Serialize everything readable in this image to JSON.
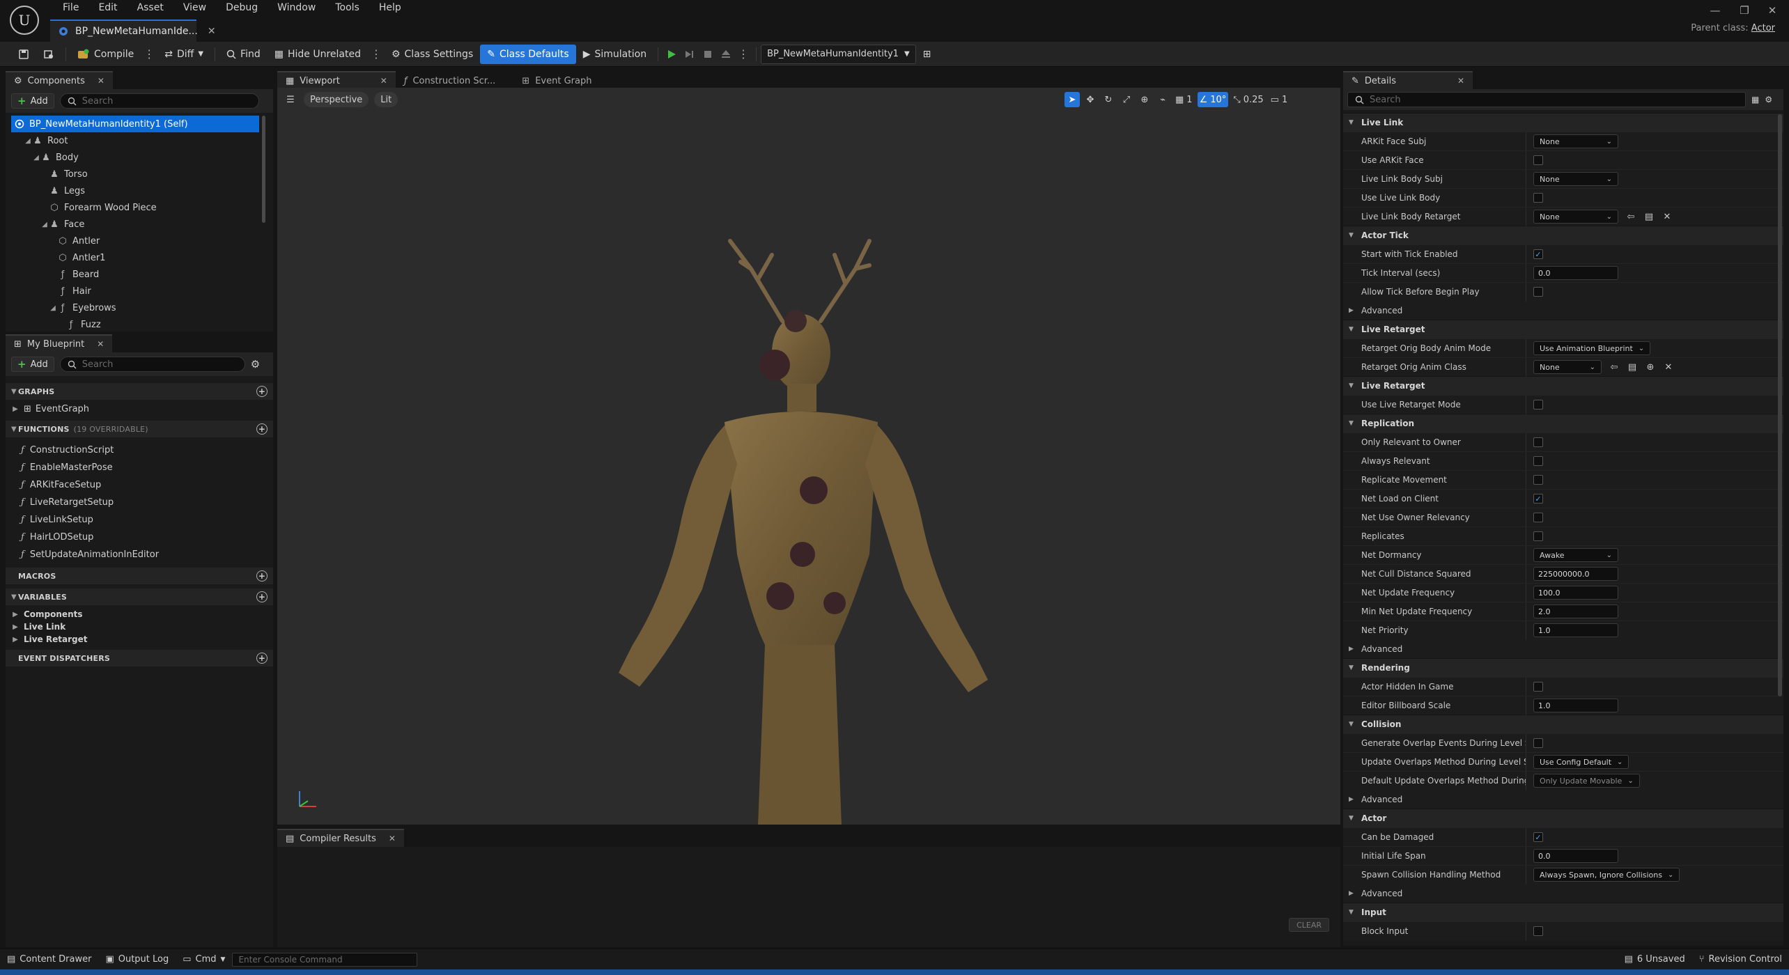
{
  "titlebar": {
    "menu": [
      "File",
      "Edit",
      "Asset",
      "View",
      "Debug",
      "Window",
      "Tools",
      "Help"
    ],
    "doc_tab": "BP_NewMetaHumanIde...",
    "parent_class_label": "Parent class:",
    "parent_class_value": "Actor"
  },
  "toolbar": {
    "compile": "Compile",
    "diff": "Diff",
    "find": "Find",
    "hide_unrelated": "Hide Unrelated",
    "class_settings": "Class Settings",
    "class_defaults": "Class Defaults",
    "simulation": "Simulation",
    "debug_object": "BP_NewMetaHumanIdentity1"
  },
  "components": {
    "tab": "Components",
    "add": "Add",
    "search_placeholder": "Search",
    "tree": [
      {
        "label": "BP_NewMetaHumanIdentity1 (Self)",
        "icon": "self-icon"
      },
      {
        "label": "Root",
        "icon": "skeletal-mesh-icon"
      },
      {
        "label": "Body",
        "icon": "skeletal-mesh-icon"
      },
      {
        "label": "Torso",
        "icon": "skeletal-mesh-icon"
      },
      {
        "label": "Legs",
        "icon": "skeletal-mesh-icon"
      },
      {
        "label": "Forearm Wood Piece",
        "icon": "static-mesh-icon"
      },
      {
        "label": "Face",
        "icon": "skeletal-mesh-icon"
      },
      {
        "label": "Antler",
        "icon": "static-mesh-icon"
      },
      {
        "label": "Antler1",
        "icon": "static-mesh-icon"
      },
      {
        "label": "Beard",
        "icon": "groom-icon"
      },
      {
        "label": "Hair",
        "icon": "groom-icon"
      },
      {
        "label": "Eyebrows",
        "icon": "groom-icon"
      },
      {
        "label": "Fuzz",
        "icon": "groom-icon"
      }
    ]
  },
  "myblueprint": {
    "tab": "My Blueprint",
    "add": "Add",
    "search_placeholder": "Search",
    "graphs_header": "GRAPHS",
    "graphs": [
      "EventGraph"
    ],
    "functions_header": "FUNCTIONS",
    "functions_count": "(19 OVERRIDABLE)",
    "functions": [
      "ConstructionScript",
      "EnableMasterPose",
      "ARKitFaceSetup",
      "LiveRetargetSetup",
      "LiveLinkSetup",
      "HairLODSetup",
      "SetUpdateAnimationInEditor"
    ],
    "macros_header": "MACROS",
    "variables_header": "VARIABLES",
    "variables": [
      "Components",
      "Live Link",
      "Live Retarget"
    ],
    "dispatchers_header": "EVENT DISPATCHERS"
  },
  "center_tabs": [
    "Viewport",
    "Construction Scr...",
    "Event Graph"
  ],
  "viewport": {
    "perspective": "Perspective",
    "lit": "Lit",
    "grid_value": "1",
    "angle_value": "10°",
    "scale_value": "0.25",
    "camera_value": "1"
  },
  "compiler": {
    "tab": "Compiler Results",
    "clear": "CLEAR"
  },
  "details": {
    "tab": "Details",
    "search_placeholder": "Search",
    "items": [
      {
        "type": "section",
        "label": "Live Link"
      },
      {
        "type": "row",
        "label": "ARKit Face Subj",
        "kind": "dropdown",
        "value": "None"
      },
      {
        "type": "row",
        "label": "Use ARKit Face",
        "kind": "check",
        "value": ""
      },
      {
        "type": "row",
        "label": "Live Link Body Subj",
        "kind": "dropdown",
        "value": "None"
      },
      {
        "type": "row",
        "label": "Use Live Link Body",
        "kind": "check",
        "value": ""
      },
      {
        "type": "row",
        "label": "Live Link Body Retarget",
        "kind": "dropdown-tools",
        "value": "None"
      },
      {
        "type": "section",
        "label": "Actor Tick"
      },
      {
        "type": "row",
        "label": "Start with Tick Enabled",
        "kind": "check",
        "value": "✓"
      },
      {
        "type": "row",
        "label": "Tick Interval (secs)",
        "kind": "number",
        "value": "0.0"
      },
      {
        "type": "row",
        "label": "Allow Tick Before Begin Play",
        "kind": "check",
        "value": ""
      },
      {
        "type": "sub",
        "label": "Advanced"
      },
      {
        "type": "section",
        "label": "Live Retarget"
      },
      {
        "type": "row",
        "label": "Retarget Orig Body Anim Mode",
        "kind": "dropdown-wide",
        "value": "Use Animation Blueprint"
      },
      {
        "type": "row",
        "label": "Retarget Orig Anim Class",
        "kind": "dropdown-tools2",
        "value": "None"
      },
      {
        "type": "section",
        "label": "Live Retarget"
      },
      {
        "type": "row",
        "label": "Use Live Retarget Mode",
        "kind": "check",
        "value": ""
      },
      {
        "type": "section",
        "label": "Replication"
      },
      {
        "type": "row",
        "label": "Only Relevant to Owner",
        "kind": "check",
        "value": ""
      },
      {
        "type": "row",
        "label": "Always Relevant",
        "kind": "check",
        "value": ""
      },
      {
        "type": "row",
        "label": "Replicate Movement",
        "kind": "check",
        "value": ""
      },
      {
        "type": "row",
        "label": "Net Load on Client",
        "kind": "check",
        "value": "✓"
      },
      {
        "type": "row",
        "label": "Net Use Owner Relevancy",
        "kind": "check",
        "value": ""
      },
      {
        "type": "row",
        "label": "Replicates",
        "kind": "check",
        "value": ""
      },
      {
        "type": "row",
        "label": "Net Dormancy",
        "kind": "dropdown",
        "value": "Awake"
      },
      {
        "type": "row",
        "label": "Net Cull Distance Squared",
        "kind": "number",
        "value": "225000000.0"
      },
      {
        "type": "row",
        "label": "Net Update Frequency",
        "kind": "number",
        "value": "100.0"
      },
      {
        "type": "row",
        "label": "Min Net Update Frequency",
        "kind": "number",
        "value": "2.0"
      },
      {
        "type": "row",
        "label": "Net Priority",
        "kind": "number",
        "value": "1.0"
      },
      {
        "type": "sub",
        "label": "Advanced"
      },
      {
        "type": "section",
        "label": "Rendering"
      },
      {
        "type": "row",
        "label": "Actor Hidden In Game",
        "kind": "check",
        "value": ""
      },
      {
        "type": "row",
        "label": "Editor Billboard Scale",
        "kind": "number",
        "value": "1.0"
      },
      {
        "type": "section",
        "label": "Collision"
      },
      {
        "type": "row",
        "label": "Generate Overlap Events During Level Stre...",
        "kind": "check",
        "value": ""
      },
      {
        "type": "row",
        "label": "Update Overlaps Method During Level Stre...",
        "kind": "dropdown-wide",
        "value": "Use Config Default"
      },
      {
        "type": "row",
        "label": "Default Update Overlaps Method During Le...",
        "kind": "dropdown-disabled",
        "value": "Only Update Movable"
      },
      {
        "type": "sub",
        "label": "Advanced"
      },
      {
        "type": "section",
        "label": "Actor"
      },
      {
        "type": "row",
        "label": "Can be Damaged",
        "kind": "check",
        "value": "✓"
      },
      {
        "type": "row",
        "label": "Initial Life Span",
        "kind": "number",
        "value": "0.0"
      },
      {
        "type": "row",
        "label": "Spawn Collision Handling Method",
        "kind": "dropdown-xwide",
        "value": "Always Spawn, Ignore Collisions"
      },
      {
        "type": "sub",
        "label": "Advanced"
      },
      {
        "type": "section",
        "label": "Input"
      },
      {
        "type": "row",
        "label": "Block Input",
        "kind": "check",
        "value": ""
      }
    ]
  },
  "bottombar": {
    "content_drawer": "Content Drawer",
    "output_log": "Output Log",
    "cmd": "Cmd",
    "console_placeholder": "Enter Console Command",
    "unsaved": "6 Unsaved",
    "revision_control": "Revision Control"
  }
}
